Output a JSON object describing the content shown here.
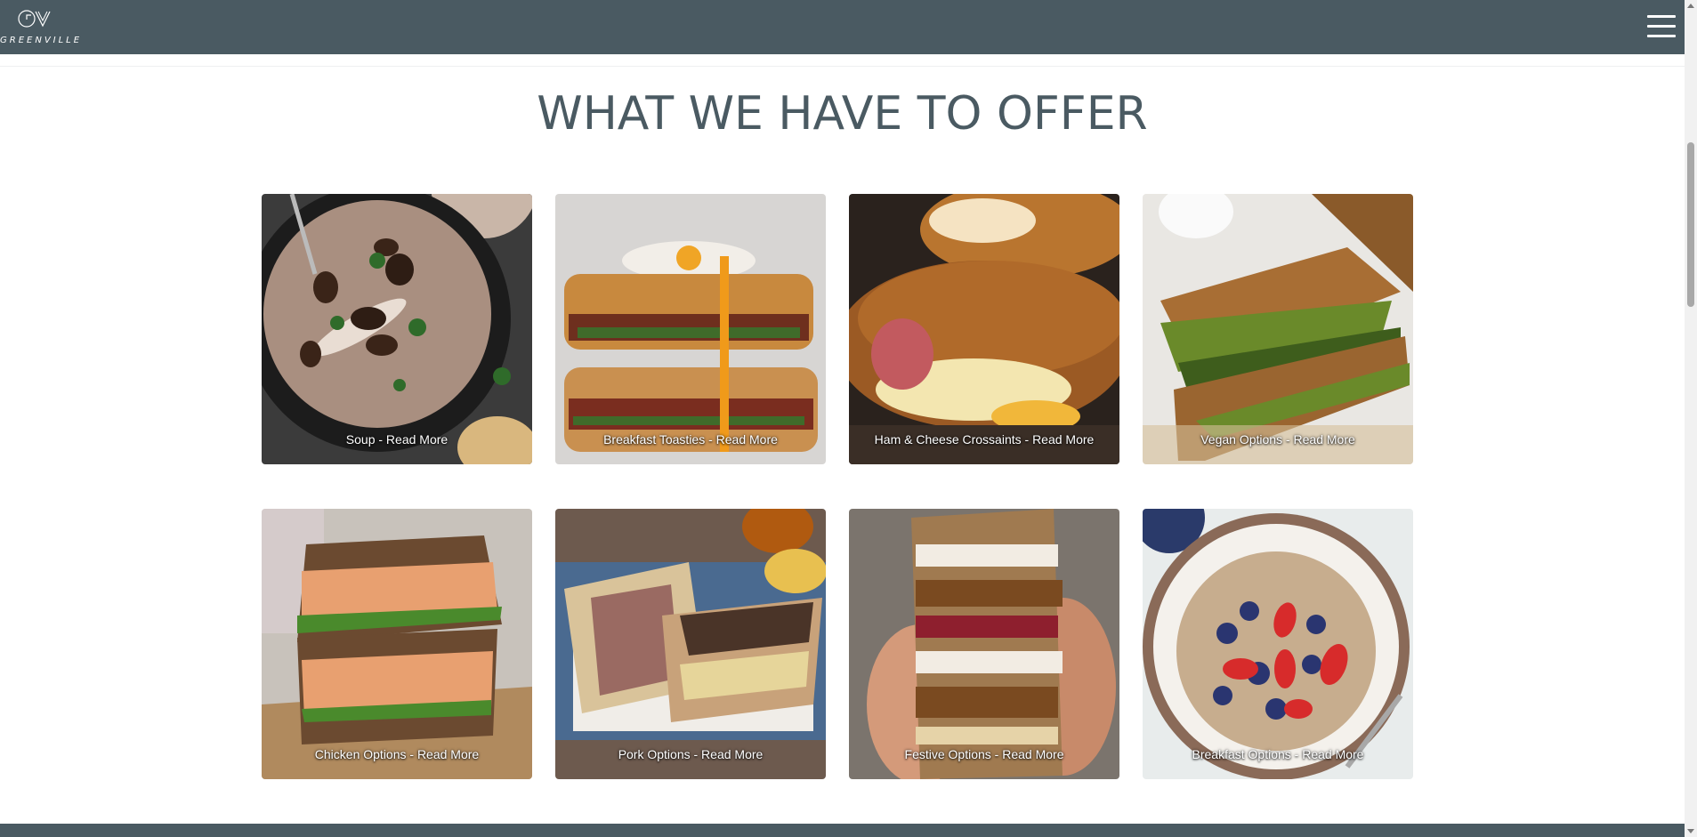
{
  "header": {
    "logo_monogram": "GV",
    "logo_text": "GREENVILLE",
    "menu_icon": "hamburger-menu-icon"
  },
  "section": {
    "title": "WHAT WE HAVE TO OFFER"
  },
  "cards": [
    {
      "label": "Soup - Read More"
    },
    {
      "label": "Breakfast Toasties - Read More"
    },
    {
      "label": "Ham & Cheese Crossaints - Read More"
    },
    {
      "label": "Vegan Options - Read More"
    },
    {
      "label": "Chicken Options - Read More"
    },
    {
      "label": "Pork Options - Read More"
    },
    {
      "label": "Festive Options - Read More"
    },
    {
      "label": "Breakfast Options - Read More"
    }
  ],
  "colors": {
    "header_bg": "#4a5a62",
    "title_text": "#4a5a62",
    "caption_text": "#ffffff"
  }
}
